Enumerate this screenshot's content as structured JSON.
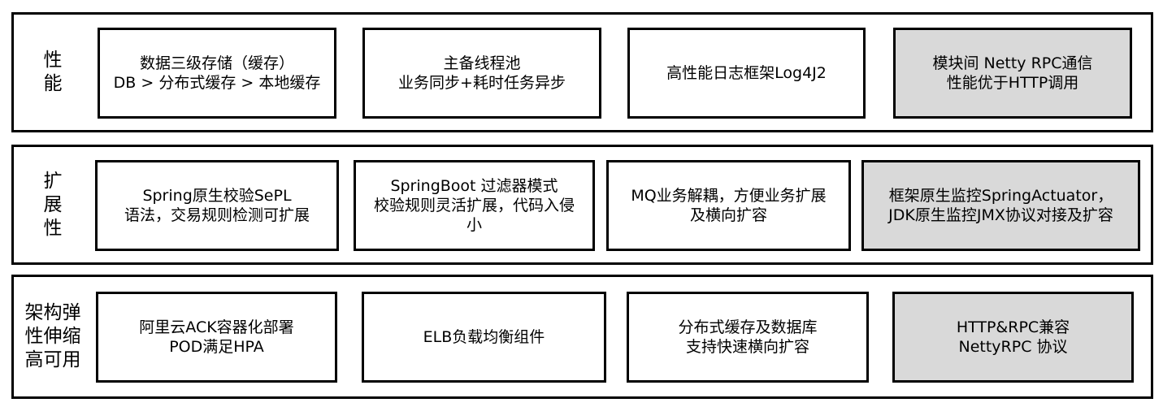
{
  "rows": [
    {
      "label": "性\n能",
      "boxes": [
        {
          "text": "数据三级存储（缓存）\nDB > 分布式缓存 > 本地缓存",
          "highlight": false
        },
        {
          "text": "主备线程池\n业务同步+耗时任务异步",
          "highlight": false
        },
        {
          "text": "高性能日志框架Log4J2",
          "highlight": false
        },
        {
          "text": "模块间 Netty RPC通信\n性能优于HTTP调用",
          "highlight": true
        }
      ]
    },
    {
      "label": "扩\n展\n性",
      "boxes": [
        {
          "text": "Spring原生校验SePL\n语法，交易规则检测可扩展",
          "highlight": false
        },
        {
          "text": "SpringBoot 过滤器模式\n校验规则灵活扩展，代码入侵\n小",
          "highlight": false
        },
        {
          "text": "MQ业务解耦，方便业务扩展\n及横向扩容",
          "highlight": false
        },
        {
          "text": "框架原生监控SpringActuator，\nJDK原生监控JMX协议对接及扩容",
          "highlight": true
        }
      ]
    },
    {
      "label": "架构弹\n性伸缩\n高可用",
      "boxes": [
        {
          "text": "阿里云ACK容器化部署\nPOD满足HPA",
          "highlight": false
        },
        {
          "text": "ELB负载均衡组件",
          "highlight": false
        },
        {
          "text": "分布式缓存及数据库\n支持快速横向扩容",
          "highlight": false
        },
        {
          "text": "HTTP&RPC兼容\nNettyRPC 协议",
          "highlight": true
        }
      ]
    }
  ],
  "colors": {
    "border": "#000000",
    "box_fill": "#ffffff",
    "highlight_fill": "#d9d9d9"
  }
}
